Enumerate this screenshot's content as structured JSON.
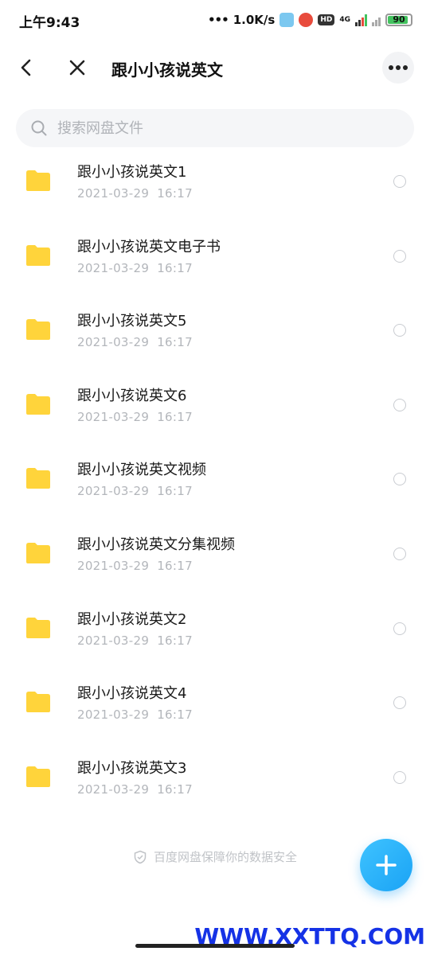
{
  "status_bar": {
    "time": "上午9:43",
    "net_speed": "1.0K/s",
    "dots": "•••",
    "hd": "HD",
    "network": "4G",
    "battery": "90"
  },
  "header": {
    "title": "跟小小孩说英文"
  },
  "search": {
    "placeholder": "搜索网盘文件"
  },
  "files": [
    {
      "name": "跟小小孩说英文1",
      "date": "2021-03-29",
      "time": "16:17"
    },
    {
      "name": "跟小小孩说英文电子书",
      "date": "2021-03-29",
      "time": "16:17"
    },
    {
      "name": "跟小小孩说英文5",
      "date": "2021-03-29",
      "time": "16:17"
    },
    {
      "name": "跟小小孩说英文6",
      "date": "2021-03-29",
      "time": "16:17"
    },
    {
      "name": "跟小小孩说英文视频",
      "date": "2021-03-29",
      "time": "16:17"
    },
    {
      "name": "跟小小孩说英文分集视频",
      "date": "2021-03-29",
      "time": "16:17"
    },
    {
      "name": "跟小小孩说英文2",
      "date": "2021-03-29",
      "time": "16:17"
    },
    {
      "name": "跟小小孩说英文4",
      "date": "2021-03-29",
      "time": "16:17"
    },
    {
      "name": "跟小小孩说英文3",
      "date": "2021-03-29",
      "time": "16:17"
    }
  ],
  "footer": {
    "security_note": "百度网盘保障你的数据安全"
  },
  "watermark": "WWW.XXTTQ.COM",
  "colors": {
    "folder": "#FFD43B",
    "fab": "#1AA3F5",
    "battery": "#43C35F"
  }
}
